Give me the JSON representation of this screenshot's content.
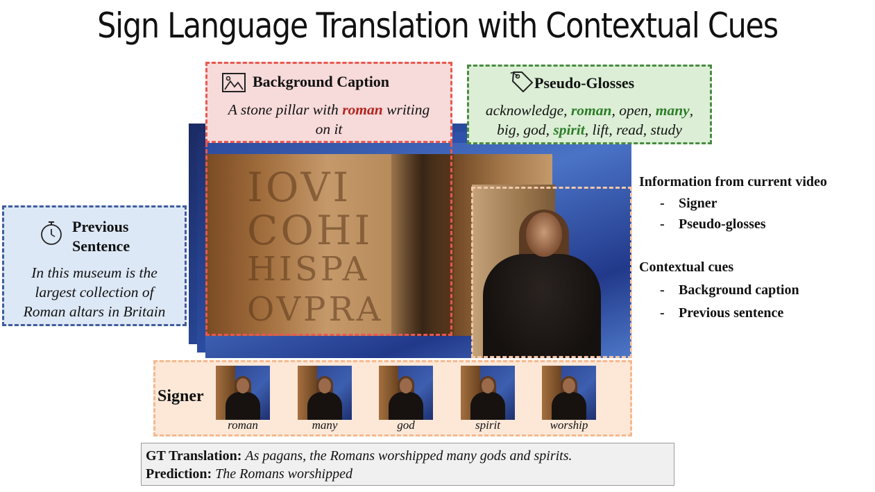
{
  "title": "Sign Language Translation with Contextual Cues",
  "background_caption": {
    "header": "Background Caption",
    "text_before": "A stone pillar with ",
    "highlight": "roman",
    "text_after": " writing",
    "text_line2": "on it",
    "icon": "image-icon",
    "color": "#e8584f"
  },
  "pseudo_glosses": {
    "header": "Pseudo-Glosses",
    "icon": "tag-icon",
    "color": "#4a8a44",
    "line1": [
      {
        "text": "acknowledge, ",
        "highlight": false
      },
      {
        "text": "roman",
        "highlight": true
      },
      {
        "text": ", open, ",
        "highlight": false
      },
      {
        "text": "many",
        "highlight": true
      },
      {
        "text": ",",
        "highlight": false
      }
    ],
    "line2": [
      {
        "text": "big, god, ",
        "highlight": false
      },
      {
        "text": "spirit",
        "highlight": true
      },
      {
        "text": ", lift, read, study",
        "highlight": false
      }
    ]
  },
  "previous_sentence": {
    "header_line1": "Previous",
    "header_line2": "Sentence",
    "icon": "stopwatch-icon",
    "color": "#3f5c9c",
    "lines": [
      "In this museum is the",
      "largest collection of",
      "Roman altars in Britain"
    ]
  },
  "video_engraving": [
    "IOVI",
    "COHI",
    "HISPA",
    "OVPRA"
  ],
  "signer": {
    "label": "Signer",
    "frames": [
      "roman",
      "many",
      "god",
      "spirit",
      "worship"
    ]
  },
  "info_panel": {
    "heading1": "Information from current video",
    "items1": [
      "Signer",
      "Pseudo-glosses"
    ],
    "heading2": "Contextual cues",
    "items2": [
      "Background caption",
      "Previous sentence"
    ],
    "bullet": "-"
  },
  "result": {
    "gt_label": "GT Translation:",
    "gt_text": "As pagans, the Romans worshipped many gods and spirits.",
    "pred_label": "Prediction:",
    "pred_text": "The Romans worshipped"
  }
}
